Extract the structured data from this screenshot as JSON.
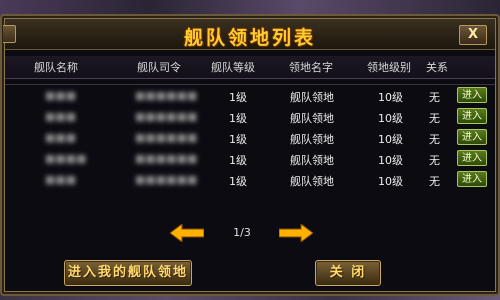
{
  "window": {
    "title": "舰队领地列表",
    "close_label": "X"
  },
  "table": {
    "columns": [
      "舰队名称",
      "舰队司令",
      "舰队等级",
      "领地名字",
      "领地级别",
      "关系"
    ],
    "rows": [
      {
        "fleet_name": "■■■",
        "commander": "■■■■■■",
        "fleet_level": "1级",
        "territory": "舰队领地",
        "territory_level": "10级",
        "relation": "无",
        "action": "进入"
      },
      {
        "fleet_name": "■■■",
        "commander": "■■■■■■",
        "fleet_level": "1级",
        "territory": "舰队领地",
        "territory_level": "10级",
        "relation": "无",
        "action": "进入"
      },
      {
        "fleet_name": "■■■",
        "commander": "■■■■■■",
        "fleet_level": "1级",
        "territory": "舰队领地",
        "territory_level": "10级",
        "relation": "无",
        "action": "进入"
      },
      {
        "fleet_name": "■■■■",
        "commander": "■■■■■■",
        "fleet_level": "1级",
        "territory": "舰队领地",
        "territory_level": "10级",
        "relation": "无",
        "action": "进入"
      },
      {
        "fleet_name": "■■■",
        "commander": "■■■■■■",
        "fleet_level": "1级",
        "territory": "舰队领地",
        "territory_level": "10级",
        "relation": "无",
        "action": "进入"
      }
    ]
  },
  "pager": {
    "text": "1/3"
  },
  "buttons": {
    "enter_my": "进入我的舰队领地",
    "close": "关 闭"
  },
  "colors": {
    "title": "#ffcc30",
    "enter_button": "#4a6a16",
    "arrow": "#ffb000"
  }
}
